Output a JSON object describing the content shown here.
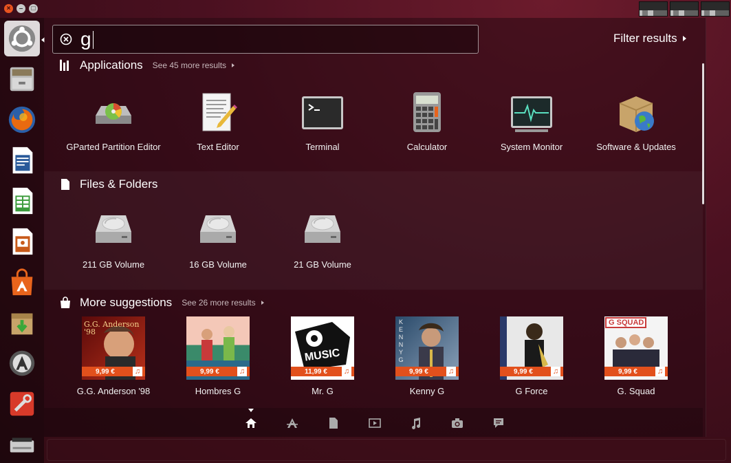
{
  "window": {
    "close": "×",
    "minimize": "–",
    "maximize": "□"
  },
  "search": {
    "value": "g",
    "filter_label": "Filter results"
  },
  "launcher": [
    {
      "name": "ubuntu-dash-icon",
      "active": true
    },
    {
      "name": "file-manager-icon"
    },
    {
      "name": "firefox-icon"
    },
    {
      "name": "libreoffice-writer-icon"
    },
    {
      "name": "libreoffice-calc-icon"
    },
    {
      "name": "libreoffice-impress-icon"
    },
    {
      "name": "ubuntu-software-center-icon"
    },
    {
      "name": "update-manager-icon"
    },
    {
      "name": "software-updater-icon"
    },
    {
      "name": "system-settings-icon"
    },
    {
      "name": "scanner-icon"
    }
  ],
  "applications": {
    "title": "Applications",
    "more": "See 45 more results",
    "items": [
      {
        "label": "GParted Partition Editor",
        "icon": "gparted-icon"
      },
      {
        "label": "Text Editor",
        "icon": "text-editor-icon"
      },
      {
        "label": "Terminal",
        "icon": "terminal-icon"
      },
      {
        "label": "Calculator",
        "icon": "calculator-icon"
      },
      {
        "label": "System Monitor",
        "icon": "system-monitor-icon"
      },
      {
        "label": "Software & Updates",
        "icon": "software-updates-icon"
      }
    ]
  },
  "files": {
    "title": "Files & Folders",
    "items": [
      {
        "label": "211 GB Volume",
        "icon": "hard-drive-icon"
      },
      {
        "label": "16 GB Volume",
        "icon": "hard-drive-icon"
      },
      {
        "label": "21 GB Volume",
        "icon": "hard-drive-icon"
      }
    ]
  },
  "suggestions": {
    "title": "More suggestions",
    "more": "See 26 more results",
    "items": [
      {
        "label": "G.G. Anderson '98",
        "price": "9,99 €",
        "cover_text": "G.G. Anderson '98",
        "bg": "#8a1a1a"
      },
      {
        "label": "Hombres G",
        "price": "9,99 €",
        "cover_text": "",
        "bg": "#3a8a6a"
      },
      {
        "label": "Mr. G",
        "price": "11,99 €",
        "cover_text": "MUSIC",
        "bg": "#ffffff"
      },
      {
        "label": "Kenny G",
        "price": "9,99 €",
        "cover_text": "KENNY G",
        "bg": "#4a6a8a"
      },
      {
        "label": "G Force",
        "price": "9,99 €",
        "cover_text": "",
        "bg": "#d8d8d8"
      },
      {
        "label": "G. Squad",
        "price": "9,99 €",
        "cover_text": "G SQUAD",
        "bg": "#f4f4f4"
      }
    ]
  },
  "lenses": [
    "home-lens-icon",
    "applications-lens-icon",
    "files-lens-icon",
    "video-lens-icon",
    "music-lens-icon",
    "photo-lens-icon",
    "social-lens-icon"
  ]
}
